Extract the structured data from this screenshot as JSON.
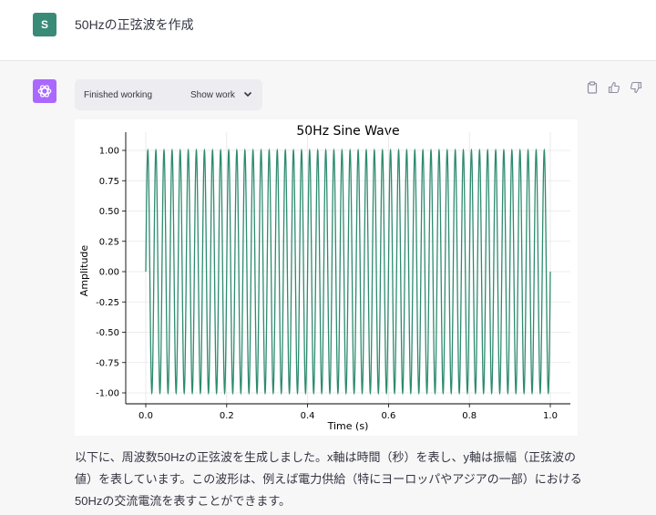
{
  "user": {
    "avatar_letter": "S",
    "message": "50Hzの正弦波を作成"
  },
  "assistant": {
    "work_status": "Finished working",
    "show_work_label": "Show work",
    "answer_text": "以下に、周波数50Hzの正弦波を生成しました。x軸は時間（秒）を表し、y軸は振幅（正弦波の値）を表しています。この波形は、例えば電力供給（特にヨーロッパやアジアの一部）における50Hzの交流電流を表すことができます。"
  },
  "icons": {
    "copy": "clipboard-icon",
    "like": "thumbs-up-icon",
    "dislike": "thumbs-down-icon",
    "chevron": "chevron-down-icon",
    "assistant_logo": "openai-logo-icon"
  },
  "colors": {
    "user_avatar": "#3a8a78",
    "assistant_avatar": "#ab68ff",
    "line": "#2e8b6e"
  },
  "chart_data": {
    "type": "line",
    "title": "50Hz Sine Wave",
    "xlabel": "Time (s)",
    "ylabel": "Amplitude",
    "xlim": [
      0,
      1
    ],
    "ylim": [
      -1,
      1
    ],
    "frequency_hz": 50,
    "xticks": [
      "0.0",
      "0.2",
      "0.4",
      "0.6",
      "0.8",
      "1.0"
    ],
    "yticks": [
      "1.00",
      "0.75",
      "0.50",
      "0.25",
      "0.00",
      "-0.25",
      "-0.50",
      "-0.75",
      "-1.00"
    ],
    "grid": true,
    "series": [
      {
        "function": "sin(2*pi*50*t)"
      }
    ]
  }
}
